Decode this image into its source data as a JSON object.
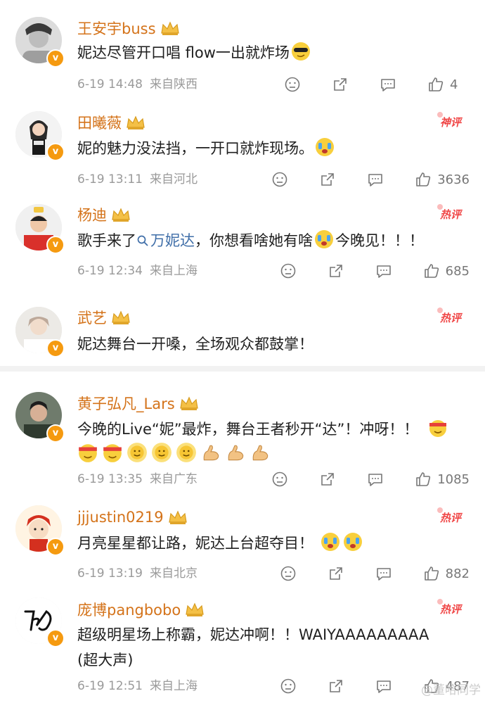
{
  "comments": [
    {
      "name": "王安宇buss",
      "text": "妮达尽管开口唱 flow一出就炸场",
      "date": "6-19 14:48",
      "location": "来自陕西",
      "likes": "4",
      "badge": ""
    },
    {
      "name": "田曦薇",
      "text": "妮的魅力没法挡，一开口就炸现场。",
      "date": "6-19 13:11",
      "location": "来自河北",
      "likes": "3636",
      "badge": "神评"
    },
    {
      "name": "杨迪",
      "text_before": "歌手来了",
      "hashtag": "万妮达",
      "text_after": "，你想看啥她有啥",
      "text_end": "今晚见！！！",
      "date": "6-19 12:34",
      "location": "来自上海",
      "likes": "685",
      "badge": "热评"
    },
    {
      "name": "武艺",
      "text": "妮达舞台一开嗓，全场观众都鼓掌！",
      "badge": "热评"
    },
    {
      "name": "黄子弘凡_Lars",
      "text": "今晚的Live“妮”最炸，舞台王者秒开“达”！冲呀！！",
      "date": "6-19 13:35",
      "location": "来自广东",
      "likes": "1085",
      "badge": ""
    },
    {
      "name": "jjjustin0219",
      "text": "月亮星星都让路，妮达上台超夺目！",
      "date": "6-19 13:19",
      "location": "来自北京",
      "likes": "882",
      "badge": "热评"
    },
    {
      "name": "庞博pangbobo",
      "text_line1": "超级明星场上称霸，妮达冲啊！！WAIYAAAAAAAAA",
      "text_line2": "(超大声)",
      "date": "6-19 12:51",
      "location": "来自上海",
      "likes": "487",
      "badge": "热评"
    }
  ],
  "watermark": "@董哈同学",
  "colors": {
    "name": "#d4731a",
    "hot": "#f04646",
    "hashtag": "#3f6ea8",
    "vbadge": "#f59a10"
  },
  "icons": [
    "dislike-icon",
    "share-icon",
    "comment-icon",
    "like-icon",
    "crown-icon",
    "v-verified-icon"
  ]
}
